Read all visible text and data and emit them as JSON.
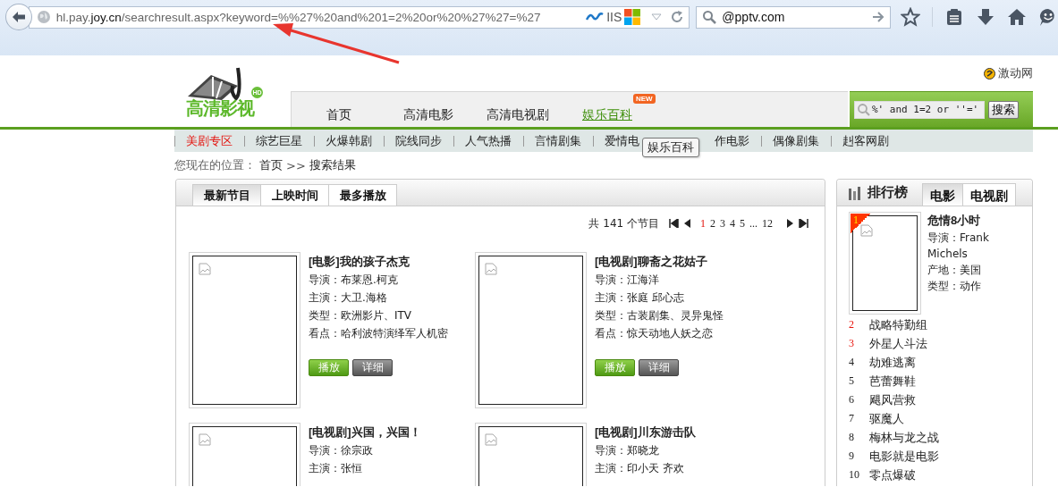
{
  "browser": {
    "address": {
      "host": "hl.pay.",
      "domain": "joy.cn",
      "path": "/searchresult.aspx?keyword=%%27%20and%201=2%20or%20%27%27=%27"
    },
    "server_badge": "IIS",
    "search": {
      "value": "@pptv.com"
    }
  },
  "header": {
    "logo": {
      "text": "高清影视",
      "badge": "HD"
    },
    "partner_link": "激动网",
    "nav": [
      {
        "label": "首页",
        "selected": false
      },
      {
        "label": "高清电影",
        "selected": false
      },
      {
        "label": "高清电视剧",
        "selected": false
      },
      {
        "label": "娱乐百科",
        "selected": true,
        "badge": "NEW"
      }
    ],
    "search": {
      "value": "%' and 1=2 or ''='",
      "button": "搜索"
    }
  },
  "subnav": [
    {
      "label": "美剧专区",
      "selected": true
    },
    {
      "label": "综艺巨星",
      "selected": false
    },
    {
      "label": "火爆韩剧",
      "selected": false
    },
    {
      "label": "院线同步",
      "selected": false
    },
    {
      "label": "人气热播",
      "selected": false
    },
    {
      "label": "言情剧集",
      "selected": false
    },
    {
      "label": "爱情电",
      "selected": false
    },
    {
      "label": "作电影",
      "selected": false
    },
    {
      "label": "偶像剧集",
      "selected": false
    },
    {
      "label": "赳客网剧",
      "selected": false
    }
  ],
  "tooltip": "娱乐百科",
  "breadcrumb": {
    "label": "您现在的位置：",
    "link": "首页",
    "separator": ">>",
    "current": "搜索结果"
  },
  "results": {
    "tabs": [
      {
        "label": "最新节目",
        "selected": true
      },
      {
        "label": "上映时间",
        "selected": false
      },
      {
        "label": "最多播放",
        "selected": false
      }
    ],
    "pagination": {
      "total": "共 141 个节目",
      "pages": [
        {
          "label": "1",
          "selected": true
        },
        {
          "label": "2",
          "selected": false
        },
        {
          "label": "3",
          "selected": false
        },
        {
          "label": "4",
          "selected": false
        },
        {
          "label": "5",
          "selected": false
        },
        {
          "label": "...",
          "selected": false
        },
        {
          "label": "12",
          "selected": false
        }
      ]
    },
    "items": [
      {
        "title": "[电影]我的孩子杰克",
        "details": [
          "导演：布莱恩.柯克",
          "主演：大卫.海格",
          "类型：欧洲影片、ITV",
          "看点：哈利波特演绎军人机密"
        ],
        "buttons": [
          "播放",
          "详细"
        ]
      },
      {
        "title": "[电视剧]聊斋之花姑子",
        "details": [
          "导演：江海洋",
          "主演：张庭 邱心志",
          "类型：古装剧集、灵异鬼怪",
          "看点：惊天动地人妖之恋"
        ],
        "buttons": [
          "播放",
          "详细"
        ]
      },
      {
        "title": "[电视剧]兴国，兴国！",
        "details": [
          "导演：徐宗政",
          "主演：张恒"
        ]
      },
      {
        "title": "[电视剧]川东游击队",
        "details": [
          "导演：郑晓龙",
          "主演：印小天 齐欢"
        ]
      }
    ]
  },
  "ranking": {
    "title": "排行榜",
    "tabs": [
      {
        "label": "电影",
        "selected": true
      },
      {
        "label": "电视剧",
        "selected": false
      }
    ],
    "top": {
      "rank": "1",
      "title": "危情8小时",
      "details": [
        "导演：Frank Michels",
        "产地：美国",
        "类型：动作"
      ]
    },
    "items": [
      {
        "rank": "2",
        "title": "战略特勤组",
        "hot": true
      },
      {
        "rank": "3",
        "title": "外星人斗法",
        "hot": true
      },
      {
        "rank": "4",
        "title": "劫难逃离",
        "hot": false
      },
      {
        "rank": "5",
        "title": "芭蕾舞鞋",
        "hot": false
      },
      {
        "rank": "6",
        "title": "飓风营救",
        "hot": false
      },
      {
        "rank": "7",
        "title": "驱魔人",
        "hot": false
      },
      {
        "rank": "8",
        "title": "梅林与龙之战",
        "hot": false
      },
      {
        "rank": "9",
        "title": "电影就是电影",
        "hot": false
      },
      {
        "rank": "10",
        "title": "零点爆破",
        "hot": false
      }
    ]
  }
}
